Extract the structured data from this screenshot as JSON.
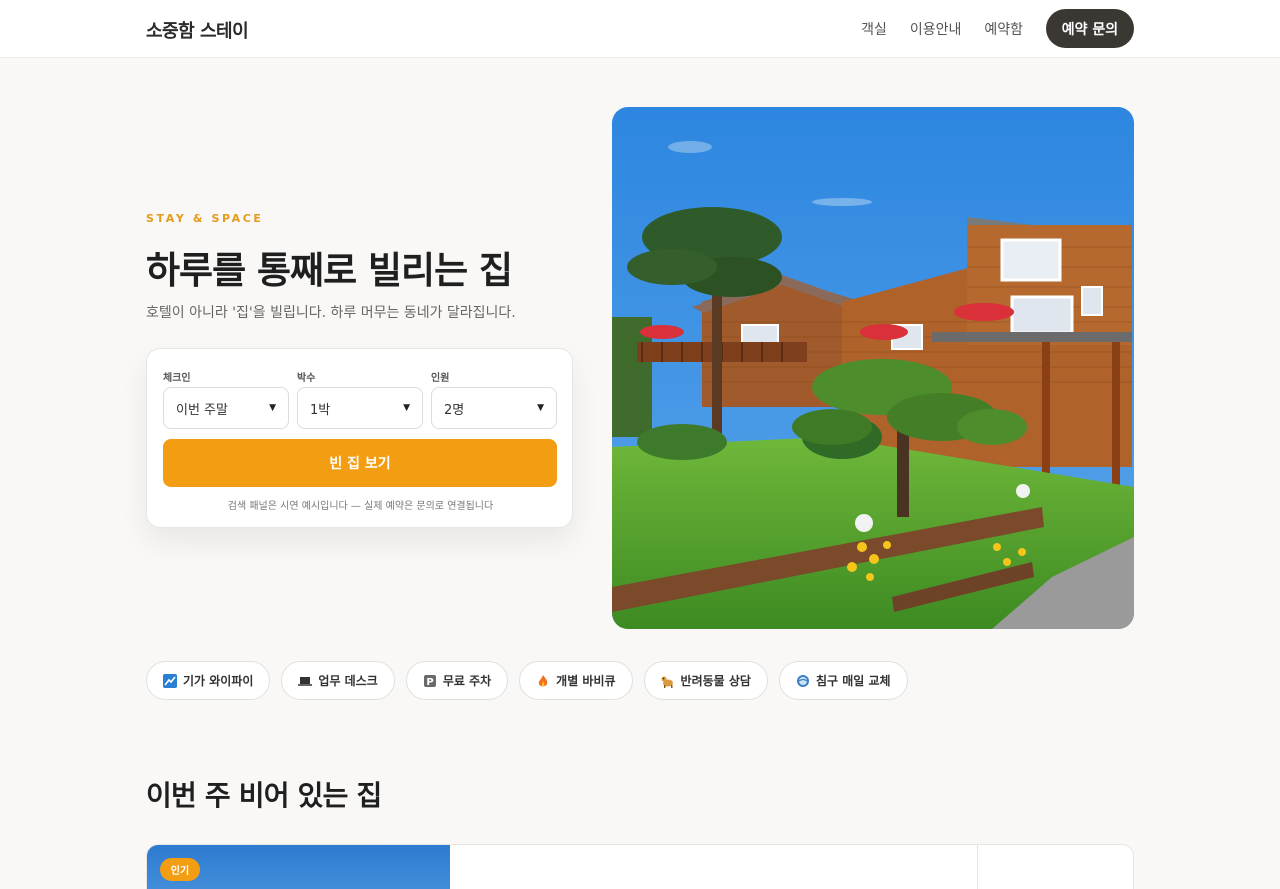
{
  "header": {
    "logo": "소중함 스테이",
    "nav": [
      "객실",
      "이용안내",
      "예약함"
    ],
    "cta": "예약 문의"
  },
  "hero": {
    "eyebrow": "STAY & SPACE",
    "title": "하루를 통째로 빌리는 집",
    "subtitle": "호텔이 아니라 '집'을 빌립니다. 하루 머무는 동네가 달라집니다.",
    "image_alt": "wooden-lodge-garden-photo"
  },
  "search": {
    "fields": [
      {
        "label": "체크인",
        "value": "이번 주말"
      },
      {
        "label": "박수",
        "value": "1박"
      },
      {
        "label": "인원",
        "value": "2명"
      }
    ],
    "button": "빈 집 보기",
    "note": "검색 패널은 시연 예시입니다 — 실제 예약은 문의로 연결됩니다"
  },
  "amenities": [
    {
      "icon": "wifi-icon",
      "label": "기가 와이파이"
    },
    {
      "icon": "laptop-icon",
      "label": "업무 데스크"
    },
    {
      "icon": "parking-icon",
      "label": "무료 주차"
    },
    {
      "icon": "fire-icon",
      "label": "개별 바비큐"
    },
    {
      "icon": "dog-icon",
      "label": "반려동물 상담"
    },
    {
      "icon": "bedding-icon",
      "label": "침구 매일 교체"
    }
  ],
  "section": {
    "title": "이번 주 비어 있는 집",
    "card_badge": "인기"
  },
  "colors": {
    "accent": "#f29d12",
    "dark": "#3b3733",
    "background": "#f9f8f6"
  }
}
